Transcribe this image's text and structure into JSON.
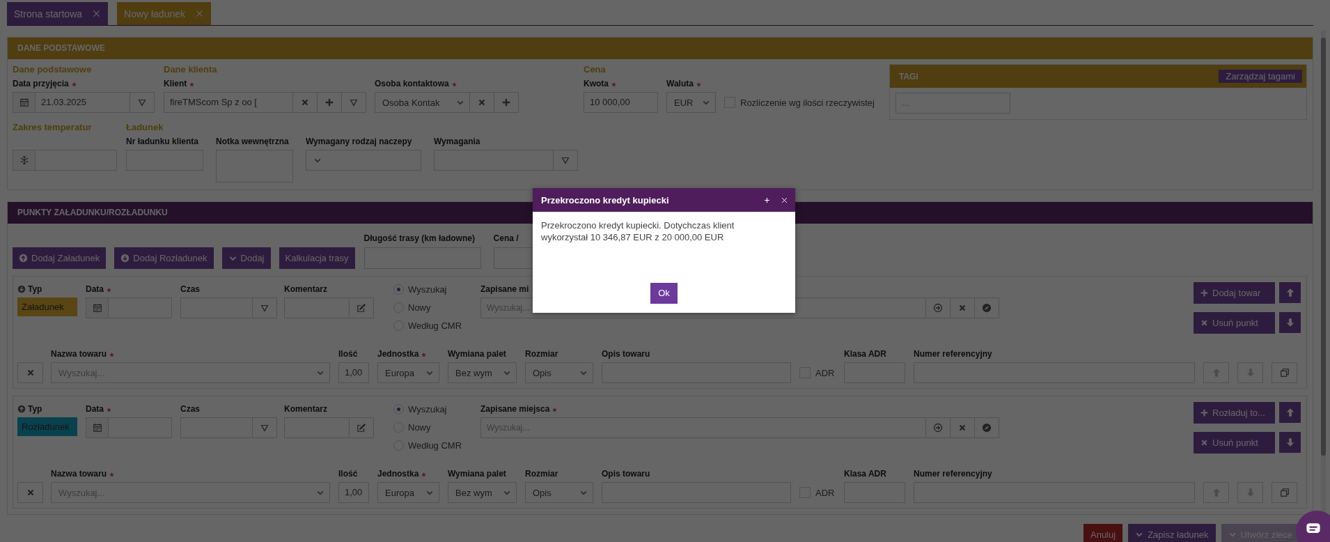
{
  "tabs": [
    {
      "label": "Strona startowa",
      "selected": false
    },
    {
      "label": "Nowy ładunek",
      "selected": true
    }
  ],
  "basic": {
    "title": "DANE PODSTAWOWE",
    "rows": [
      [
        {
          "heading": "Dane podstawowe",
          "fields": [
            {
              "kind": "date",
              "label": "Data przyjęcia",
              "required": true,
              "value": "21.03.2025"
            }
          ]
        },
        {
          "heading": "Dane klienta",
          "fields": [
            {
              "kind": "client",
              "label": "Klient",
              "required": true,
              "value": "fireTMScom Sp z oo ["
            },
            {
              "kind": "contact",
              "label": "Osoba kontaktowa",
              "required": true,
              "value": "Osoba Kontak"
            }
          ]
        },
        {
          "heading": "Cena",
          "fields": [
            {
              "kind": "text",
              "label": "Kwota",
              "required": true,
              "value": "10 000,00"
            },
            {
              "kind": "select",
              "label": "Waluta",
              "required": true,
              "value": "EUR"
            },
            {
              "kind": "checkbox",
              "label": "Rozliczenie wg ilości rzeczywistej",
              "checked": false
            }
          ]
        }
      ],
      [
        {
          "heading": "Zakres temperatur",
          "fields": [
            {
              "kind": "temperature"
            }
          ]
        },
        {
          "heading": "Ładunek",
          "fields": [
            {
              "kind": "text",
              "label": "Nr ładunku klienta",
              "required": false
            },
            {
              "kind": "textarea",
              "label": "Notka wewnętrzna",
              "required": false
            },
            {
              "kind": "select",
              "label": "Wymagany rodzaj naczepy",
              "required": false
            },
            {
              "kind": "picker",
              "label": "Wymagania",
              "required": false
            }
          ]
        }
      ]
    ],
    "tags": {
      "title": "TAGI",
      "button": "Zarządzaj tagami",
      "placeholder": "..."
    }
  },
  "points_section": {
    "title": "PUNKTY ZAŁADUNKU/ROZŁADUNKU",
    "buttons": [
      {
        "label": "Dodaj Załadunek",
        "kind": "load"
      },
      {
        "label": "Dodaj Rozładunek",
        "kind": "unload"
      },
      {
        "label": "Dodaj",
        "kind": "dropdown"
      },
      {
        "label": "Kalkulacja trasy",
        "kind": "plain"
      }
    ],
    "fields": [
      {
        "label": "Długość trasy (km ładowne)"
      },
      {
        "label": "Cena /"
      }
    ],
    "points": [
      {
        "kind": "loading",
        "type_label": "Typ",
        "type": "Załadunek",
        "date_label": "Data",
        "date_required": true,
        "time_label": "Czas",
        "comment_label": "Komentarz",
        "options": [
          {
            "label": "Wyszukaj",
            "selected": true
          },
          {
            "label": "Nowy",
            "selected": false
          },
          {
            "label": "Według CMR",
            "selected": false
          }
        ],
        "place_label": "Zapisane mi",
        "place_required": false,
        "place_placeholder": "Wyszukaj...",
        "add_button": "Dodaj towar",
        "remove_button": "Usuń punkt",
        "goods": {
          "name_label": "Nazwa towaru",
          "name_required": true,
          "name_placeholder": "Wyszukaj...",
          "quantity_label": "Ilość",
          "quantity": "1,00",
          "unit_label": "Jednostka",
          "unit_required": true,
          "unit": "Europa",
          "pallets_label": "Wymiana palet",
          "pallets": "Bez wym",
          "size_label": "Rozmiar",
          "size": "Opis",
          "description_label": "Opis towaru",
          "adr_label": "ADR",
          "adr": false,
          "adr_class_label": "Klasa ADR",
          "reference_label": "Numer referencyjny"
        }
      },
      {
        "kind": "unloading",
        "type_label": "Typ",
        "type": "Rozładunek",
        "date_label": "Data",
        "date_required": true,
        "time_label": "Czas",
        "comment_label": "Komentarz",
        "options": [
          {
            "label": "Wyszukaj",
            "selected": true
          },
          {
            "label": "Nowy",
            "selected": false
          },
          {
            "label": "Według CMR",
            "selected": false
          }
        ],
        "place_label": "Zapisane miejsca",
        "place_required": true,
        "place_placeholder": "Wyszukaj...",
        "add_button": "Rozładuj to...",
        "remove_button": "Usuń punkt",
        "goods": {
          "name_label": "Nazwa towaru",
          "name_required": true,
          "name_placeholder": "Wyszukaj...",
          "quantity_label": "Ilość",
          "quantity": "1,00",
          "unit_label": "Jednostka",
          "unit_required": true,
          "unit": "Europa",
          "pallets_label": "Wymiana palet",
          "pallets": "Bez wym",
          "size_label": "Rozmiar",
          "size": "Opis",
          "description_label": "Opis towaru",
          "adr_label": "ADR",
          "adr": false,
          "adr_class_label": "Klasa ADR",
          "reference_label": "Numer referencyjny"
        }
      }
    ]
  },
  "footer": [
    {
      "label": "Anuluj",
      "kind": "cancel",
      "disabled": false
    },
    {
      "label": "Zapisz ładunek",
      "kind": "save",
      "disabled": false
    },
    {
      "label": "Utwórz zlece",
      "kind": "save",
      "disabled": true
    }
  ],
  "modal": {
    "title": "Przekroczono kredyt kupiecki",
    "message": "Przekroczono kredyt kupiecki. Dotychczas klient wykorzystał 10 346,87 EUR z 20 000,00 EUR",
    "button": "Ok"
  }
}
